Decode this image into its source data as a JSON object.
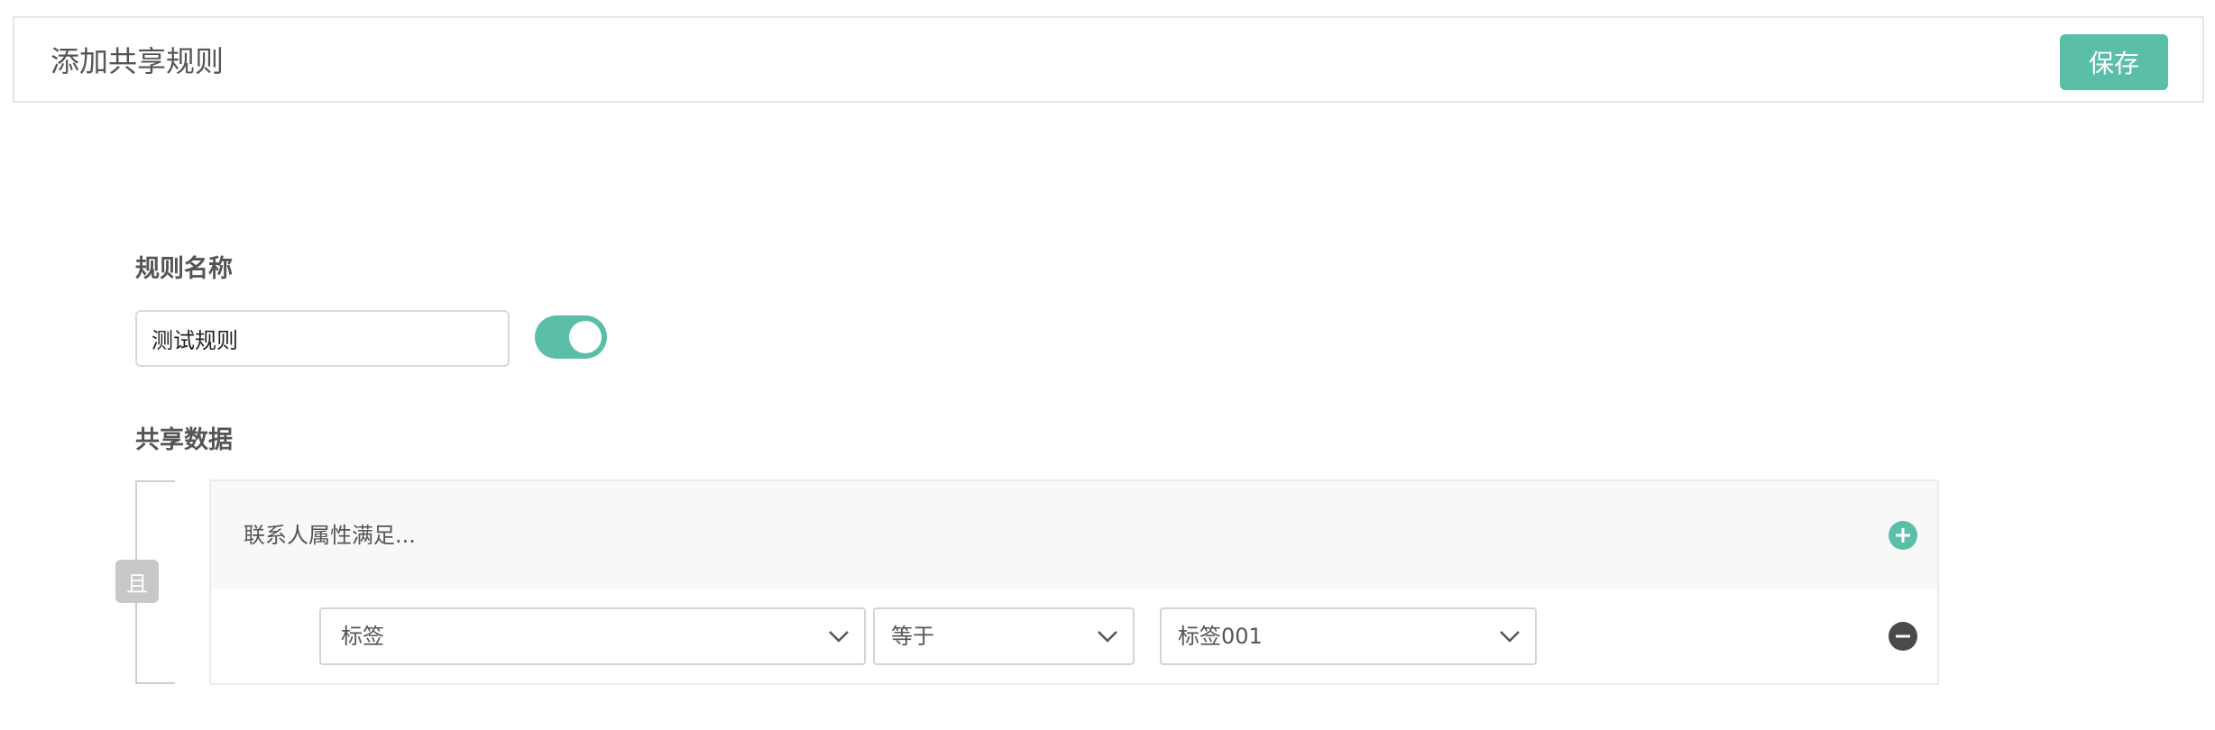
{
  "header": {
    "title": "添加共享规则",
    "save_label": "保存"
  },
  "rule_name": {
    "label": "规则名称",
    "value": "测试规则",
    "enabled": true
  },
  "shared_data": {
    "label": "共享数据",
    "logic_badge": "且",
    "group_title": "联系人属性满足...",
    "condition": {
      "field": "标签",
      "operator": "等于",
      "value": "标签001"
    }
  },
  "colors": {
    "accent": "#5bbfa7",
    "remove": "#4a4a4a",
    "badge": "#c8c8c8"
  },
  "icons": {
    "add": "plus-circle-icon",
    "remove": "minus-circle-icon",
    "dropdown": "chevron-down-icon"
  }
}
